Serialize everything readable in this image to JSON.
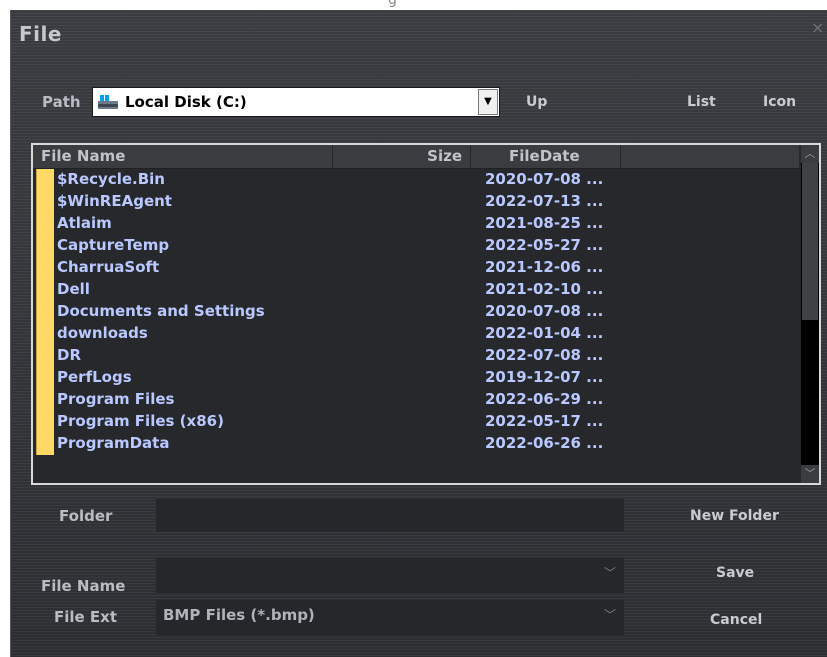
{
  "dialog": {
    "title": "File",
    "close_glyph": "×",
    "path_label": "Path",
    "path_value": "Local Disk (C:)",
    "path_icon": "drive-icon",
    "dropdown_glyph": "▼",
    "up_label": "Up",
    "list_label": "List",
    "icon_label": "Icon"
  },
  "file_list": {
    "columns": {
      "name": "File Name",
      "size": "Size",
      "date": "FileDate"
    },
    "rows": [
      {
        "name": "$Recycle.Bin",
        "date": "2020-07-08 ..."
      },
      {
        "name": "$WinREAgent",
        "date": "2022-07-13 ..."
      },
      {
        "name": "Atlaim",
        "date": "2021-08-25 ..."
      },
      {
        "name": "CaptureTemp",
        "date": "2022-05-27 ..."
      },
      {
        "name": "CharruaSoft",
        "date": "2021-12-06 ..."
      },
      {
        "name": "Dell",
        "date": "2021-02-10 ..."
      },
      {
        "name": "Documents and Settings",
        "date": "2020-07-08 ..."
      },
      {
        "name": "downloads",
        "date": "2022-01-04 ..."
      },
      {
        "name": "DR",
        "date": "2022-07-08 ..."
      },
      {
        "name": "PerfLogs",
        "date": "2019-12-07 ..."
      },
      {
        "name": "Program Files",
        "date": "2022-06-29 ..."
      },
      {
        "name": "Program Files (x86)",
        "date": "2022-05-17 ..."
      },
      {
        "name": "ProgramData",
        "date": "2022-06-26 ..."
      }
    ],
    "scroll_up_glyph": "︿",
    "scroll_down_glyph": "﹀"
  },
  "form": {
    "folder_label": "Folder",
    "folder_value": "",
    "new_folder_label": "New Folder",
    "file_name_label": "File Name",
    "file_name_value": "",
    "save_label": "Save",
    "file_ext_label": "File Ext",
    "file_ext_value": "BMP Files (*.bmp)",
    "cancel_label": "Cancel",
    "select_glyph": "﹀"
  },
  "colors": {
    "background": "#2f3135",
    "text": "#c8cbd2",
    "list_text": "#b9c8ff",
    "folder_icon": "#ffd966"
  }
}
